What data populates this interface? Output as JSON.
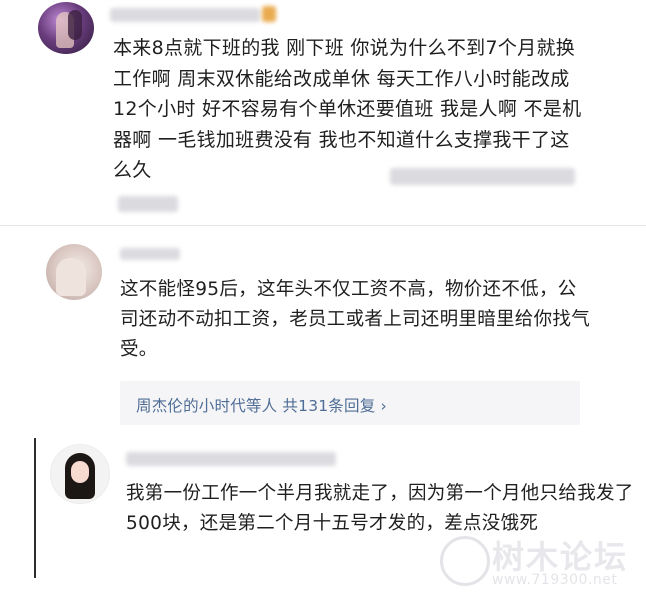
{
  "comments": [
    {
      "text": "本来8点就下班的我 刚下班 你说为什么不到7个月就换工作啊 周末双休能给改成单休 每天工作八小时能改成12个小时 好不容易有个单休还要值班 我是人啊 不是机器啊 一毛钱加班费没有 我也不知道什么支撑我干了这么久"
    },
    {
      "text": "这不能怪95后，这年头不仅工资不高，物价还不低，公司还动不动扣工资，老员工或者上司还明里暗里给你找气受。",
      "replies_link": "周杰伦的小时代等人 共131条回复 ›"
    },
    {
      "text": "我第一份工作一个半月我就走了，因为第一个月他只给我发了500块，还是第二个月十五号才发的，差点没饿死"
    }
  ],
  "watermark": {
    "logo": "树木论坛",
    "url": "www.719300.net"
  }
}
